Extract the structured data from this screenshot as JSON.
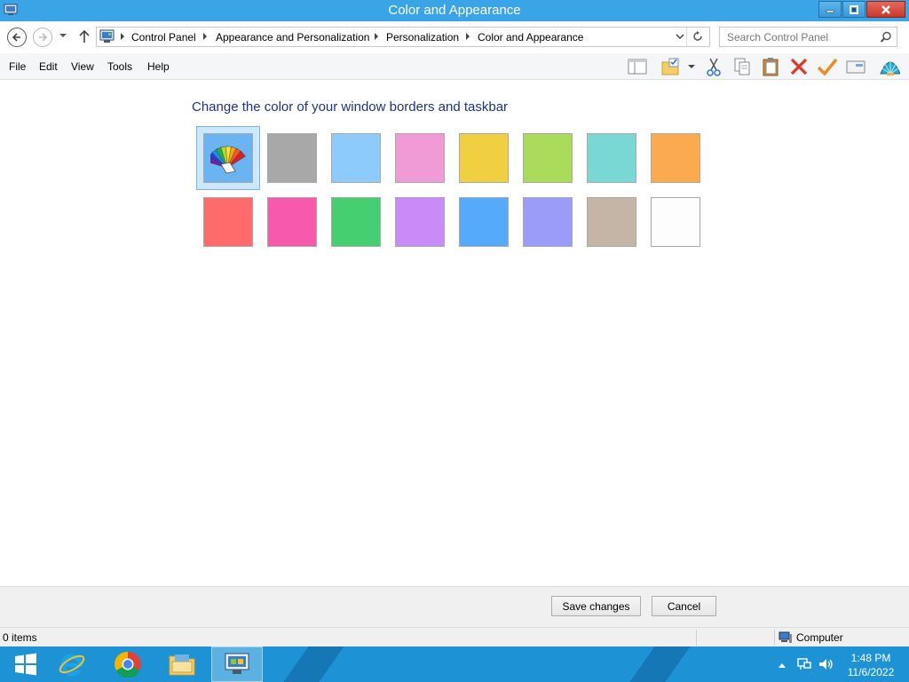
{
  "window": {
    "title": "Color and Appearance"
  },
  "nav": {
    "breadcrumbs": [
      "Control Panel",
      "Appearance and Personalization",
      "Personalization",
      "Color and Appearance"
    ],
    "search_placeholder": "Search Control Panel"
  },
  "menu": {
    "items": [
      "File",
      "Edit",
      "View",
      "Tools",
      "Help"
    ]
  },
  "toolbar": {
    "icons": [
      "preview-pane-icon",
      "folder-options-icon",
      "cut-icon",
      "copy-icon",
      "paste-icon",
      "delete-icon",
      "properties-check-icon",
      "email-icon",
      "shell-icon"
    ]
  },
  "content": {
    "heading": "Change the color of your window borders and taskbar",
    "swatches": [
      {
        "name": "color-mixer",
        "color": "#6ab4f2",
        "selected": true
      },
      {
        "name": "gray",
        "color": "#a8a8a8"
      },
      {
        "name": "light-blue",
        "color": "#8ccbfb"
      },
      {
        "name": "pink",
        "color": "#f09ad6"
      },
      {
        "name": "yellow",
        "color": "#f0d040"
      },
      {
        "name": "lime",
        "color": "#abdb5a"
      },
      {
        "name": "teal",
        "color": "#79d8d4"
      },
      {
        "name": "orange",
        "color": "#fcaa4f"
      },
      {
        "name": "red",
        "color": "#ff6b6b"
      },
      {
        "name": "magenta",
        "color": "#f75aad"
      },
      {
        "name": "green",
        "color": "#45cf71"
      },
      {
        "name": "purple",
        "color": "#c98bf7"
      },
      {
        "name": "blue",
        "color": "#56aafb"
      },
      {
        "name": "periwinkle",
        "color": "#9b9bf9"
      },
      {
        "name": "taupe",
        "color": "#c4b5a7"
      },
      {
        "name": "white",
        "color": "#fdfdfd"
      }
    ]
  },
  "buttons": {
    "save": "Save changes",
    "cancel": "Cancel"
  },
  "status": {
    "items": "0 items",
    "location": "Computer"
  },
  "taskbar": {
    "apps": [
      "start-icon",
      "internet-explorer-icon",
      "chrome-icon",
      "file-explorer-icon",
      "control-panel-icon"
    ],
    "time": "1:48 PM",
    "date": "11/6/2022"
  }
}
